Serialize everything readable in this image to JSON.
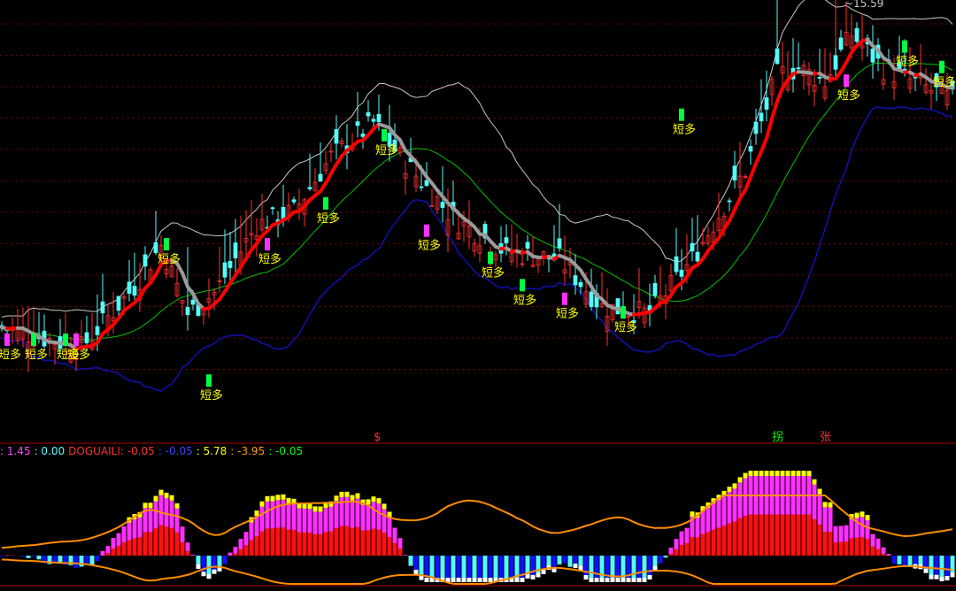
{
  "chart_data": [
    {
      "type": "candlestick",
      "panel": "main",
      "title": "",
      "peak_label": "15.59",
      "signal_label": "短多",
      "signal_points": [
        {
          "i": 1,
          "y": 11.0
        },
        {
          "i": 6,
          "y": 11.0
        },
        {
          "i": 12,
          "y": 11.0
        },
        {
          "i": 14,
          "y": 11.0
        },
        {
          "i": 31,
          "y": 12.4
        },
        {
          "i": 39,
          "y": 10.4
        },
        {
          "i": 50,
          "y": 12.4
        },
        {
          "i": 61,
          "y": 13.0
        },
        {
          "i": 72,
          "y": 14.0
        },
        {
          "i": 80,
          "y": 12.6
        },
        {
          "i": 92,
          "y": 12.2
        },
        {
          "i": 98,
          "y": 11.8
        },
        {
          "i": 106,
          "y": 11.6
        },
        {
          "i": 117,
          "y": 11.4
        },
        {
          "i": 128,
          "y": 14.3
        },
        {
          "i": 159,
          "y": 14.8
        },
        {
          "i": 170,
          "y": 15.3
        },
        {
          "i": 177,
          "y": 15.0
        }
      ],
      "colors": {
        "up": "#ff3030",
        "down": "#54fcfc",
        "ma_up": "#ff0000",
        "ma_down": "#9a9a9a",
        "ma_slow": "#00c000",
        "upper_band": "#c8c8c8",
        "lower_band": "#1010b0",
        "signal_text": "#ffff00"
      }
    },
    {
      "type": "bar",
      "panel": "indicator",
      "labels": [
        {
          "text": ": 1.45",
          "color": "#ff44ff"
        },
        {
          "text": ": 0.00",
          "color": "#54fcfc"
        },
        {
          "text": "DOGUAILI: -0.05",
          "color": "#ff3030"
        },
        {
          "text": ": -0.05",
          "color": "#4040ff"
        },
        {
          "text": ": 5.78",
          "color": "#ffff00"
        },
        {
          "text": ": -3.95",
          "color": "#ff9900"
        },
        {
          "text": ": -0.05",
          "color": "#00ff00"
        }
      ],
      "markers": [
        {
          "i": 71,
          "text": "$",
          "color": "#ff3030"
        },
        {
          "i": 146,
          "text": "拐",
          "color": "#00ff00"
        },
        {
          "i": 155,
          "text": "张",
          "color": "#ff3030"
        }
      ],
      "colors": {
        "pos_red": "#ff1010",
        "pos_magenta": "#ff30ff",
        "pos_yellow": "#ffff00",
        "neg_blue": "#1010ff",
        "neg_cyan": "#54fcfc",
        "neg_white": "#ffffff",
        "band": "#ff8c00"
      }
    }
  ]
}
